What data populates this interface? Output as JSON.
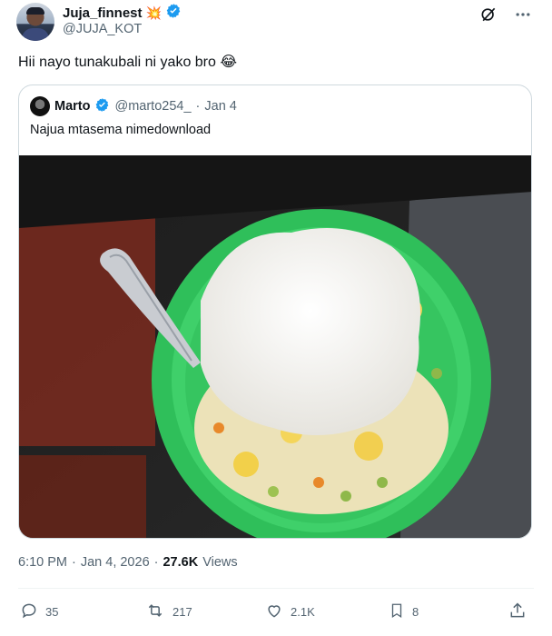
{
  "author": {
    "display_name": "Juja_finnest",
    "name_emoji": "💥",
    "handle": "@JUJA_KOT"
  },
  "tweet": {
    "text": "Hii nayo tunakubali ni yako bro 😂"
  },
  "quoted": {
    "display_name": "Marto",
    "handle": "@marto254_",
    "separator": "·",
    "date": "Jan 4",
    "text": "Najua mtasema nimedownload"
  },
  "meta": {
    "time": "6:10 PM",
    "sep1": "·",
    "date": "Jan 4, 2026",
    "sep2": "·",
    "views": "27.6K",
    "views_label": "Views"
  },
  "actions": {
    "replies": "35",
    "reposts": "217",
    "likes": "2.1K",
    "bookmarks": "8"
  },
  "colors": {
    "text_primary": "#0f1419",
    "text_secondary": "#536471",
    "verified": "#1d9bf0",
    "border": "#cfd9de",
    "plate_green": "#2fbf5a"
  },
  "icons": [
    "verified-icon",
    "grok-icon",
    "more-icon",
    "reply-icon",
    "repost-icon",
    "like-icon",
    "bookmark-icon",
    "share-icon"
  ]
}
